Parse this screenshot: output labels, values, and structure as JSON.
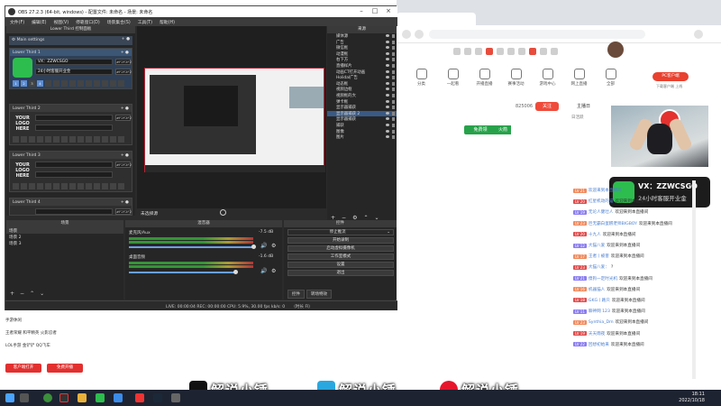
{
  "obs": {
    "title": "OBS 27.2.3 (64-bit, windows) - 配置文件: 未命名 - 场景: 未命名",
    "menu": [
      "文件(F)",
      "编辑(E)",
      "视图(V)",
      "停靠窗口(D)",
      "场景集合(S)",
      "工具(T)",
      "帮助(H)"
    ],
    "lower_third_dock_title": "Lower Third 控制面板",
    "main_settings_label": "Main settings",
    "cards": [
      {
        "title": "Lower Third 1",
        "name": "VX：ZZWCSGO",
        "info": "24小时客服开业金",
        "color": "#F2F2F2"
      },
      {
        "title": "Lower Third 2",
        "name": "",
        "info": "",
        "color": "#F2F2F2"
      },
      {
        "title": "Lower Third 3",
        "name": "",
        "info": "",
        "color": "#F2F2F2"
      },
      {
        "title": "Lower Third 4",
        "name": "",
        "info": "",
        "color": "#F2F2F2"
      }
    ],
    "logo_placeholder": "YOUR LOGO HERE",
    "lt1_numbers": [
      "1",
      "2",
      "3",
      "4"
    ],
    "preview_label": "未选择源",
    "sources_title": "来源",
    "sources": [
      "媒体源",
      "广告",
      "微信框",
      "动漫框",
      "右下方",
      "直播样片",
      "动画CT打开动画",
      "Holidal广告",
      "动态框",
      "视频边框",
      "视频框的大",
      "弹卡框",
      "显示器捕获",
      "显示器捕获 2",
      "显示器捕获",
      "捕获",
      "图像",
      "图片"
    ],
    "selected_source_index": 13,
    "scenes_title": "场景",
    "scenes": [
      "场景",
      "场景 2",
      "场景 3"
    ],
    "mixer_title": "混音器",
    "mixer": [
      {
        "name": "麦克风/Aux",
        "db": "-7.5 dB"
      },
      {
        "name": "桌面音频",
        "db": "-1.6 dB"
      }
    ],
    "controls_title": "控件",
    "controls": [
      "停止推流",
      "开始录制",
      "启动虚拟摄像机",
      "工作室模式",
      "设置",
      "退出"
    ],
    "controls_tabs": [
      "控件",
      "转场特效"
    ],
    "status": "LIVE: 00:00:04   REC: 00:00:00   CPU: 5.9%, 30.00 fps   kb/s: 0",
    "recording_label": "（时长 Fl）"
  },
  "browser": {
    "tab_title": "PC客户端",
    "search_placeholder": "搜索",
    "nav": [
      "分类",
      "一起看",
      "开播直播",
      "赛事活动",
      "游戏中心",
      "网上直播",
      "全部",
      "更多"
    ],
    "pc_client": "PC客户端",
    "sub_text": "下载客户端 上线",
    "room_number": "825006",
    "follow_button": "关注",
    "free_gift": "免费领",
    "free_gift_suffix": "火箭",
    "sidebar_tab": "主播日",
    "sidebar_tab2": "日活跃",
    "wx_name": "VX：ZZWCSGO",
    "wx_subtitle": "24小时客服开业金",
    "chat": [
      {
        "lv": "LV 21",
        "user": "欢迎来到本直播间",
        "msg": ""
      },
      {
        "lv": "LV 20",
        "user": "红星机动的猫",
        "msg": "欢迎来到本直播间"
      },
      {
        "lv": "LV 19",
        "user": "无论人健壮人",
        "msg": "欢迎来到本直播间"
      },
      {
        "lv": "LV 23",
        "user": "巨无霸白蛋糕老师BIGBOY",
        "msg": "欢迎来到本直播间"
      },
      {
        "lv": "LV 20",
        "user": "十九人",
        "msg": "欢迎来到本直播间"
      },
      {
        "lv": "LV 12",
        "user": "大猫八爱",
        "msg": "欢迎来到本直播间"
      },
      {
        "lv": "LV 17",
        "user": "王者丨被害",
        "msg": "欢迎来到本直播间"
      },
      {
        "lv": "LV 23",
        "user": "大猫八爱：",
        "msg": "?"
      },
      {
        "lv": "LV 21",
        "user": "傻狗一定时光机",
        "msg": "欢迎来到本直播间"
      },
      {
        "lv": "LV 16",
        "user": "机器猫人",
        "msg": "欢迎来到本直播间"
      },
      {
        "lv": "LV 18",
        "user": "GKG丨路只",
        "msg": "欢迎来到本直播间"
      },
      {
        "lv": "LV 11",
        "user": "聊神网 123",
        "msg": "欢迎来到本直播间"
      },
      {
        "lv": "LV 23",
        "user": "Synthia_Dm",
        "msg": "欢迎来到本直播间"
      },
      {
        "lv": "LV 19",
        "user": "天天雨夜",
        "msg": "欢迎来到本直播间"
      },
      {
        "lv": "LV 22",
        "user": "回想初始来",
        "msg": "欢迎来到本直播间"
      }
    ]
  },
  "left_panel": {
    "rows": [
      "手游休闲",
      "王者荣耀  和平精英  火影忍者",
      "LOL手游  金铲铲  QQ飞车"
    ],
    "btn1": "客户端打开",
    "btn2": "免费开播"
  },
  "watermarks": [
    "解说小锤",
    "解说小锤",
    "解说小锤"
  ],
  "taskbar": {
    "time": "18:11",
    "date": "2022/10/18"
  }
}
